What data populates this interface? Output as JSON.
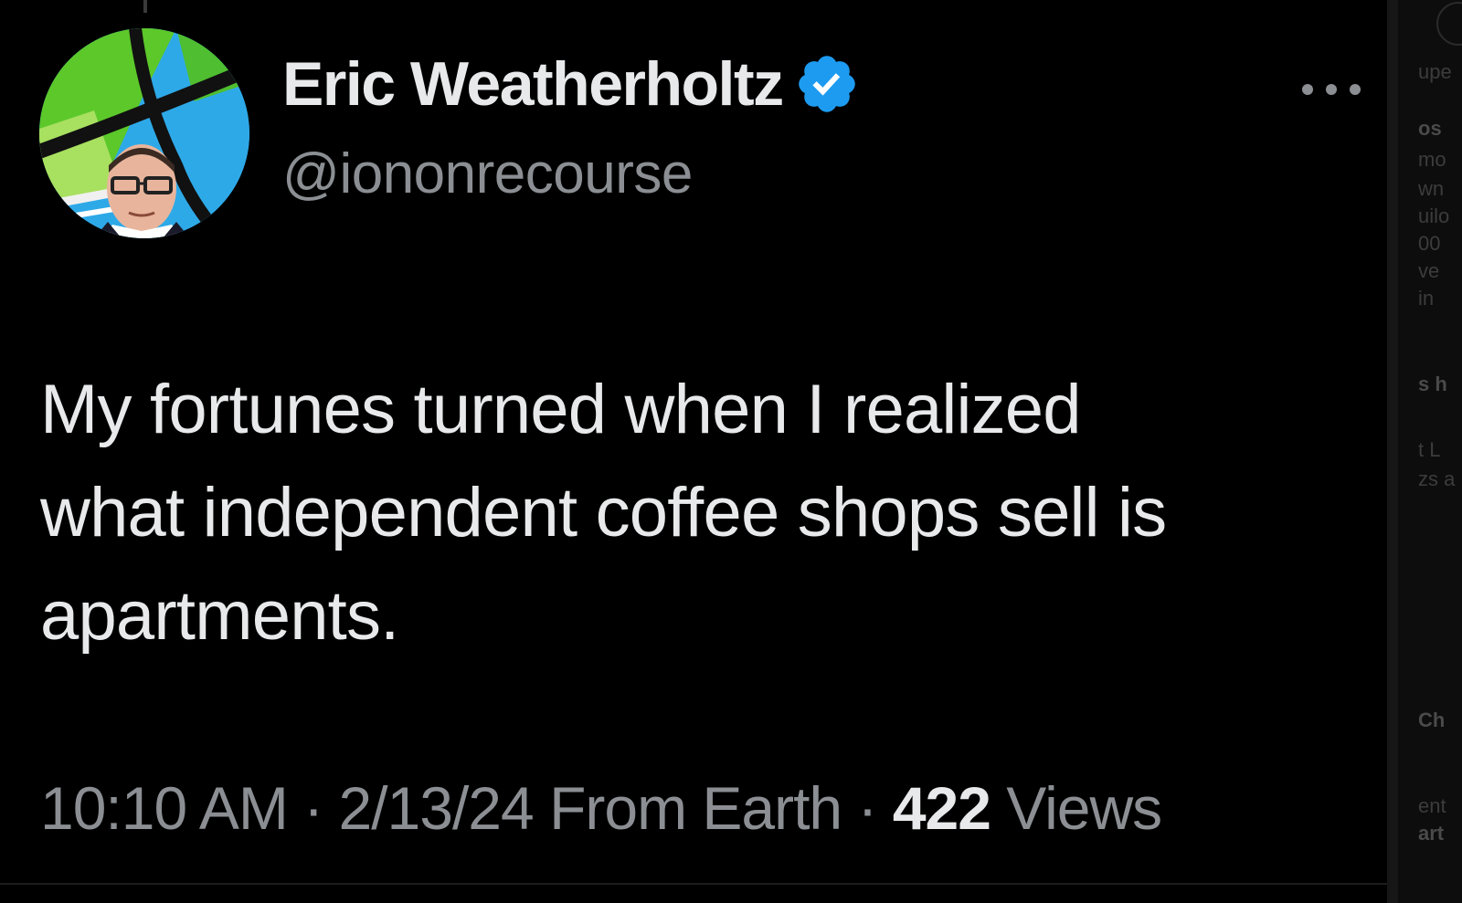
{
  "tweet": {
    "author": {
      "display_name": "Eric Weatherholtz",
      "handle": "@iononrecourse",
      "verified": true,
      "verified_color": "#1d9bf0"
    },
    "text": "My fortunes turned when I realized\nwhat independent coffee shops sell is\napartments.",
    "time": "10:10 AM",
    "separator": " · ",
    "date": "2/13/24",
    "source": "From Earth",
    "views_count": "422",
    "views_label": " Views",
    "more_icon": "ellipsis-horizontal-icon"
  },
  "colors": {
    "background": "#000000",
    "primary_text": "#e7e9ea",
    "secondary_text": "#8b8f93",
    "accent": "#1d9bf0"
  }
}
